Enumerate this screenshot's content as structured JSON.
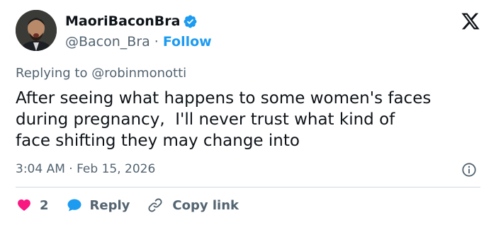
{
  "author": {
    "display_name": "MaoriBaconBra",
    "handle": "@Bacon_Bra",
    "separator": "·",
    "follow_label": "Follow",
    "verified_color": "#1d9bf0"
  },
  "header": {
    "logo": "x-logo-icon"
  },
  "reply_context": {
    "prefix": "Replying to ",
    "mention": "@robinmonotti"
  },
  "tweet": {
    "text": "After seeing what happens to some women's faces\nduring pregnancy,  I'll never trust what kind of\nface shifting they may change into",
    "timestamp": "3:04 AM · Feb 15, 2026"
  },
  "actions": {
    "like_count": "2",
    "reply_label": "Reply",
    "copy_label": "Copy link",
    "like_color": "#f91880",
    "reply_color": "#1d9bf0"
  },
  "icons": [
    "verified-badge-icon",
    "x-logo-icon",
    "info-icon",
    "heart-icon",
    "speech-bubble-icon",
    "link-icon"
  ]
}
